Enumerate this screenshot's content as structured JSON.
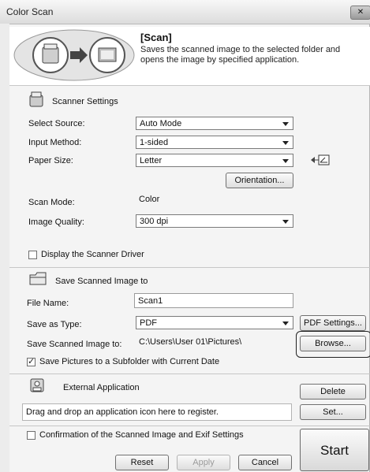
{
  "window": {
    "title": "Color Scan",
    "close_label": "✕"
  },
  "banner": {
    "heading": "[Scan]",
    "description": "Saves the scanned image to the selected folder and opens the image by specified application."
  },
  "scanner": {
    "section_title": "Scanner Settings",
    "source_label": "Select Source:",
    "source_value": "Auto Mode",
    "input_label": "Input Method:",
    "input_value": "1-sided",
    "paper_label": "Paper Size:",
    "paper_value": "Letter",
    "orientation_button": "Orientation...",
    "mode_label": "Scan Mode:",
    "mode_value": "Color",
    "quality_label": "Image Quality:",
    "quality_value": "300 dpi",
    "driver_checkbox": "Display the Scanner Driver",
    "driver_checked": false
  },
  "save": {
    "section_title": "Save Scanned Image to",
    "filename_label": "File Name:",
    "filename_value": "Scan1",
    "type_label": "Save as Type:",
    "type_value": "PDF",
    "pdf_settings_button": "PDF Settings...",
    "path_label": "Save Scanned Image to:",
    "path_value": "C:\\Users\\User 01\\Pictures\\",
    "browse_button": "Browse...",
    "subfolder_checkbox": "Save Pictures to a Subfolder with Current Date",
    "subfolder_checked": true
  },
  "external": {
    "section_title": "External Application",
    "delete_button": "Delete",
    "drop_hint": "Drag and drop an application icon here to register.",
    "set_button": "Set..."
  },
  "footer": {
    "confirm_checkbox": "Confirmation of the Scanned Image and Exif Settings",
    "confirm_checked": false,
    "reset_button": "Reset",
    "apply_button": "Apply",
    "cancel_button": "Cancel",
    "start_button": "Start"
  },
  "icons": [
    "scanner-icon",
    "arrow-right-icon",
    "photo-frame-icon",
    "folder-icon",
    "application-icon",
    "paper-orientation-icon",
    "close-icon"
  ]
}
